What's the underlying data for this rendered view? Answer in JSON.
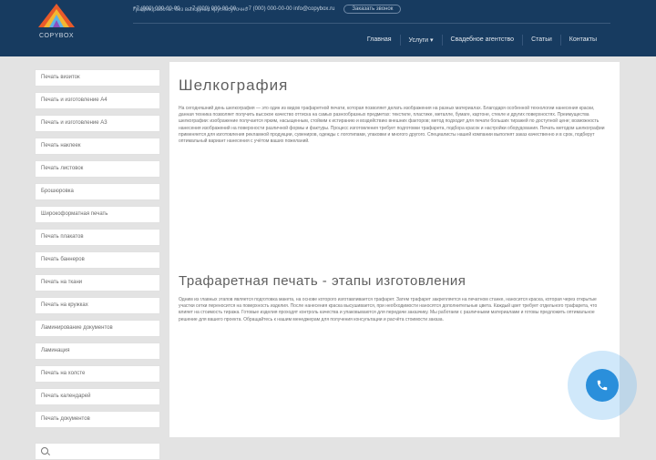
{
  "header": {
    "logo_text": "COPYBOX",
    "contacts": [
      "+7 (000) 000-00-00",
      "+7 (000) 000-00-00",
      "+7 (000) 000-00-00 info@copybox.ru"
    ],
    "callback_label": "Заказать звонок",
    "schedule": "График работы: без выходных круглосуточно"
  },
  "nav": {
    "items": [
      "Главная",
      "Услуги ▾",
      "Свадебное агентство",
      "Статьи",
      "Контакты"
    ]
  },
  "sidebar": {
    "items": [
      "Печать визиток",
      "Печать и изготовление А4",
      "Печать и изготовление А3",
      "Печать наклеек",
      "Печать листовок",
      "Брошюровка",
      "Широкоформатная печать",
      "Печать плакатов",
      "Печать баннеров",
      "Печать на ткани",
      "Печать на кружках",
      "Ламинирование документов",
      "Ламинация",
      "Печать на холсте",
      "Печать календарей",
      "Печать документов"
    ],
    "search_icon": "search-icon"
  },
  "content": {
    "title": "Шелкография",
    "paragraph1": "На сегодняшний день шелкография — это один из видов трафаретной печати, которая позволяет делать изображения на разных материалах. Благодаря особенной технологии нанесения краски, данная техника позволяет получить высокое качество оттиска на самых разнообразных предметах: текстиле, пластике, металле, бумаге, картоне, стекле и других поверхностях. Преимущества шелкографии: изображение получается ярким, насыщенным, стойким к истиранию и воздействию внешних факторов; метод подходит для печати больших тиражей по доступной цене; возможность нанесения изображений на поверхности различной формы и фактуры. Процесс изготовления требует подготовки трафарета, подбора красок и настройки оборудования. Печать методом шелкографии применяется для изготовления рекламной продукции, сувениров, одежды с логотипами, упаковки и многого другого. Специалисты нашей компании выполнят заказ качественно и в срок, подберут оптимальный вариант нанесения с учётом ваших пожеланий.",
    "subtitle": "Трафаретная печать - этапы изготовления",
    "paragraph2": "Одним из главных этапов является подготовка макета, на основе которого изготавливается трафарет. Затем трафарет закрепляется на печатном станке, наносится краска, которая через открытые участки сетки переносится на поверхность изделия. После нанесения краска высушивается, при необходимости наносятся дополнительные цвета. Каждый цвет требует отдельного трафарета, что влияет на стоимость тиража. Готовые изделия проходят контроль качества и упаковываются для передачи заказчику. Мы работаем с различными материалами и готовы предложить оптимальное решение для вашего проекта. Обращайтесь к нашим менеджерам для получения консультации и расчёта стоимости заказа."
  },
  "call_button": {
    "icon": "phone-icon",
    "color": "#2a8fdb"
  }
}
